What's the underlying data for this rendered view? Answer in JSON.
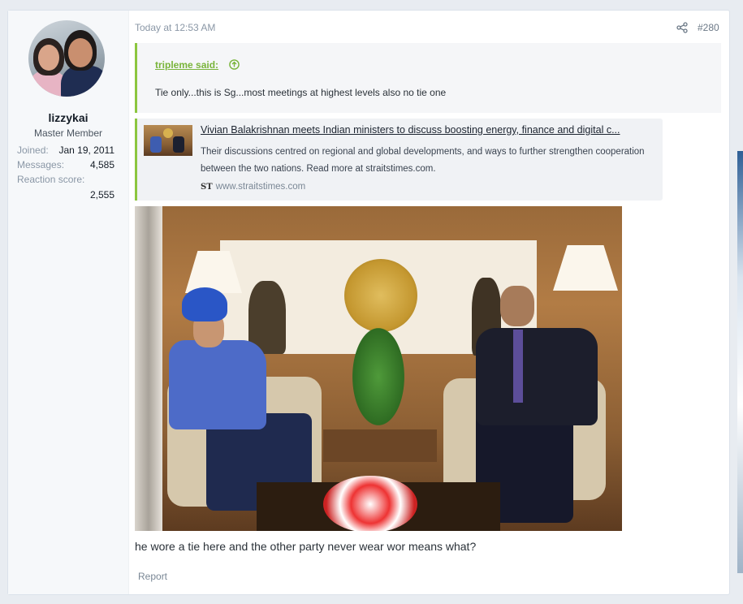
{
  "post": {
    "timestamp": "Today at 12:53 AM",
    "post_number": "#280",
    "share_icon": "share-icon",
    "body_text": "he wore a tie here and the other party never wear wor means what?",
    "report_label": "Report"
  },
  "user": {
    "name": "lizzykai",
    "title": "Master Member",
    "stats": [
      {
        "label": "Joined:",
        "value": "Jan 19, 2011"
      },
      {
        "label": "Messages:",
        "value": "4,585"
      },
      {
        "label": "Reaction score:",
        "value": "2,555"
      }
    ]
  },
  "quote": {
    "author": "tripleme said:",
    "arrow_icon": "arrow-up-circle-icon",
    "text": "Tie only...this is Sg...most meetings at highest levels also no tie one"
  },
  "unfurl": {
    "title": "Vivian Balakrishnan meets Indian ministers to discuss boosting energy, finance and digital c...",
    "description": "Their discussions centred on regional and global developments, and ways to further strengthen cooperation between the two nations. Read more at straitstimes.com.",
    "site_logo": "ST",
    "site": "www.straitstimes.com"
  },
  "colors": {
    "accent_green": "#8cc63f",
    "quote_author": "#79b43a",
    "page_bg": "#e8ecf1"
  }
}
